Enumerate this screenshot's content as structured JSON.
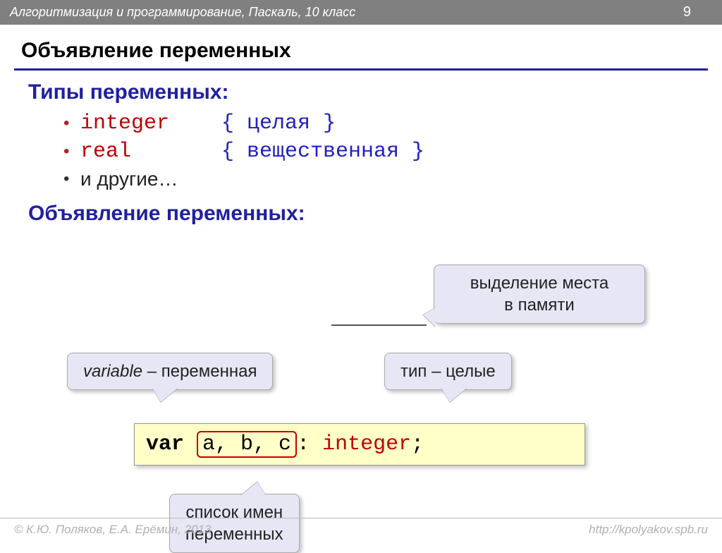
{
  "header": {
    "course": "Алгоритмизация и программирование, Паскаль, 10 класс",
    "page": "9"
  },
  "title": "Объявление переменных",
  "sections": {
    "types_heading": "Типы переменных:",
    "decl_heading": "Объявление переменных:"
  },
  "types": [
    {
      "name": "integer",
      "comment": "{ целая }"
    },
    {
      "name": "real",
      "comment": "{ вещественная }"
    }
  ],
  "others_text": "и другие…",
  "callouts": {
    "memory": "выделение места\nв памяти",
    "variable_prefix": "variable",
    "variable_rest": " – переменная",
    "type": "тип – целые",
    "list": "список имен\nпеременных"
  },
  "code": {
    "kw": "var",
    "vars": "a, b, c",
    "colon": ":",
    "type": "integer",
    "semi": ";"
  },
  "footer": {
    "copyright": "© К.Ю. Поляков, Е.А. Ерёмин, 2013",
    "url": "http://kpolyakov.spb.ru"
  }
}
